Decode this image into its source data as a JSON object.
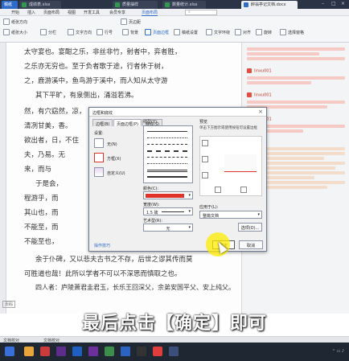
{
  "tabs": [
    {
      "label": "成绩表.xlsx",
      "color": "#2e9a4e"
    },
    {
      "label": "质量抽样",
      "color": "#2e9a4e"
    },
    {
      "label": "数量统计.xlsx",
      "color": "#2e9a4e"
    },
    {
      "label": "醉翁亭记文档.docx",
      "color": "#2f6bc8"
    }
  ],
  "ribbon": {
    "menus": [
      "开始",
      "插入",
      "页面布局",
      "引用",
      "审阅",
      "视图",
      "章节",
      "开发工具",
      "会员专享",
      "页面布局"
    ],
    "buttons": [
      "纸张方向",
      "纸张大小",
      "分栏",
      "文字方向",
      "行号",
      "页边距",
      "背景",
      "页面边框",
      "稿纸设置",
      "文字环绕",
      "对齐",
      "旋转",
      "选择窗格"
    ]
  },
  "document_lines": [
    "太守宴也。宴酣之乐，非丝非竹，射者中，弈者胜，",
    "之乐亦无穷也。至于负者歌于途，行者休于树，",
    "之，鹿游溪中，鱼鸟游于溪中，而人知从太守游",
    "其下平旷，有泉侧出，涌溢若沸。",
    "然，有穴窈然，凉，",
    "清冽甘美，香。",
    "欲出者，日，不住",
    "夫，乃易。无",
    "来，而与",
    "于是会，",
    "程游乎，而",
    "其山也，而",
    "不能至，而",
    "不能至也，",
    "余于仆碑，又以悲夫古书之不存，后世之谬其传而莫",
    "可胜道也哉！此所以学者不可以不深思而慎取之也。",
    "四人者：庐陵萧君圭君玉，长乐王回深父，余弟安国平父、安上纯父。"
  ],
  "comments": [
    {
      "user": "linxu001"
    },
    {
      "user": "linxu001"
    },
    {
      "user": "linxu001"
    }
  ],
  "dialog": {
    "title": "边框和底纹",
    "tabs": [
      "边框(B)",
      "页面边框(P)",
      "底纹(S)"
    ],
    "settings_label": "设置:",
    "settings": [
      "无(N)",
      "方框(X)",
      "自定义(U)"
    ],
    "style_label": "线型(Y):",
    "color_label": "颜色(C):",
    "color_value": "#e0332a",
    "width_label": "宽度(W):",
    "width_value": "1.5 磅",
    "art_label": "艺术型(R):",
    "art_value": "无",
    "preview_label": "预览",
    "preview_hint": "单击下方图示或使用按钮可设置边框",
    "apply_label": "应用于(L):",
    "apply_value": "整篇文档",
    "options_button": "选项(O)...",
    "help_link": "操作技巧",
    "ok": "确定",
    "cancel": "取消"
  },
  "subtitle": "最后点击【确定】即可",
  "status": {
    "page": "页码",
    "left": "文档校对",
    "word_count": "文档校对"
  }
}
